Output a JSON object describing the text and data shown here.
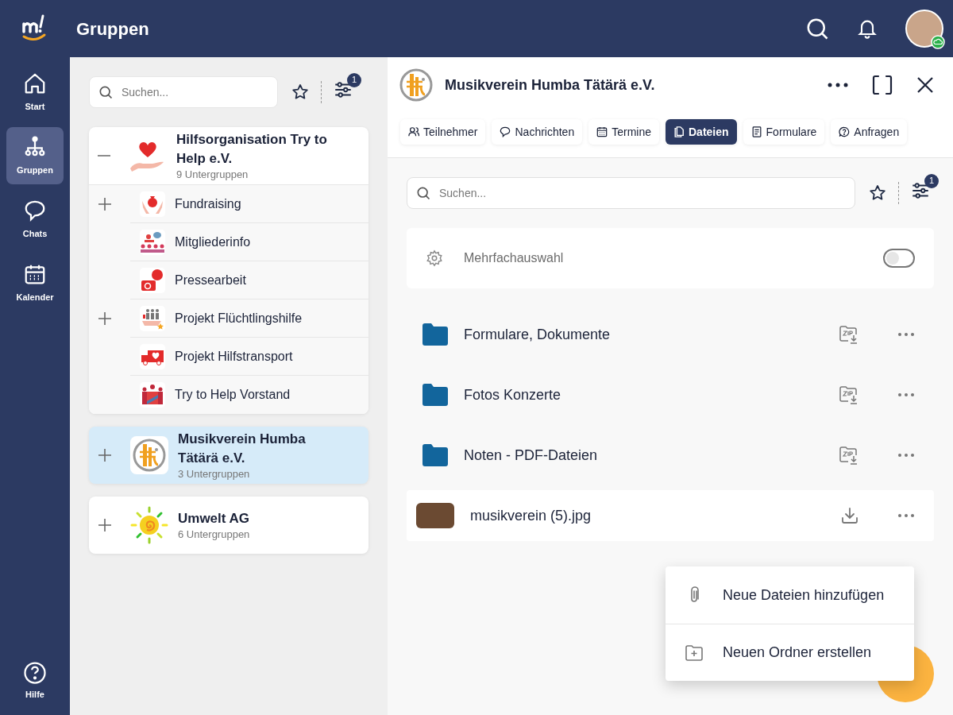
{
  "header": {
    "title": "Gruppen"
  },
  "nav": [
    {
      "label": "Start",
      "kind": "home",
      "selected": false
    },
    {
      "label": "Gruppen",
      "kind": "groups",
      "selected": true
    },
    {
      "label": "Chats",
      "kind": "chat",
      "selected": false
    },
    {
      "label": "Kalender",
      "kind": "calendar",
      "selected": false
    }
  ],
  "help": {
    "label": "Hilfe"
  },
  "group_list": {
    "search": {
      "placeholder": "Suchen..."
    },
    "filter_count": "1",
    "groups": [
      {
        "name": "Hilfsorganisation Try to Help e.V.",
        "subtitle": "9 Untergruppen",
        "kind": "heart",
        "expanded": true,
        "selected": false,
        "children": [
          {
            "name": "Fundraising",
            "kind": "money",
            "expandable": true
          },
          {
            "name": "Mitgliederinfo",
            "kind": "people",
            "expandable": false
          },
          {
            "name": "Pressearbeit",
            "kind": "camera",
            "expandable": false
          },
          {
            "name": "Projekt Flüchtlingshilfe",
            "kind": "family",
            "expandable": true
          },
          {
            "name": "Projekt Hilfstransport",
            "kind": "truck",
            "expandable": false
          },
          {
            "name": "Try to Help Vorstand",
            "kind": "board",
            "expandable": false
          }
        ]
      },
      {
        "name": "Musikverein Humba Tätärä e.V.",
        "subtitle": "3 Untergruppen",
        "kind": "music",
        "expanded": false,
        "selected": true
      },
      {
        "name": "Umwelt AG",
        "subtitle": "6 Untergruppen",
        "kind": "sun",
        "expanded": false,
        "selected": false
      }
    ]
  },
  "detail": {
    "title": "Musikverein Humba Tätärä e.V.",
    "tabs": [
      {
        "label": "Teilnehmer",
        "kind": "people",
        "selected": false
      },
      {
        "label": "Nachrichten",
        "kind": "chat",
        "selected": false
      },
      {
        "label": "Termine",
        "kind": "calendar",
        "selected": false
      },
      {
        "label": "Dateien",
        "kind": "file",
        "selected": true
      },
      {
        "label": "Formulare",
        "kind": "form",
        "selected": false
      },
      {
        "label": "Anfragen",
        "kind": "question",
        "selected": false
      }
    ],
    "search": {
      "placeholder": "Suchen..."
    },
    "filter_count": "1",
    "multiselect": {
      "label": "Mehrfachauswahl",
      "on": false
    },
    "files": [
      {
        "kind": "folder",
        "name": "Formulare, Dokumente",
        "selected": false
      },
      {
        "kind": "folder",
        "name": "Fotos Konzerte",
        "selected": false
      },
      {
        "kind": "folder",
        "name": "Noten - PDF-Dateien",
        "selected": false
      },
      {
        "kind": "image",
        "name": "musikverein (5).jpg",
        "selected": true
      }
    ],
    "menu": [
      {
        "kind": "attach",
        "label": "Neue Dateien hinzufügen"
      },
      {
        "kind": "new-folder",
        "label": "Neuen Ordner erstellen"
      }
    ]
  }
}
